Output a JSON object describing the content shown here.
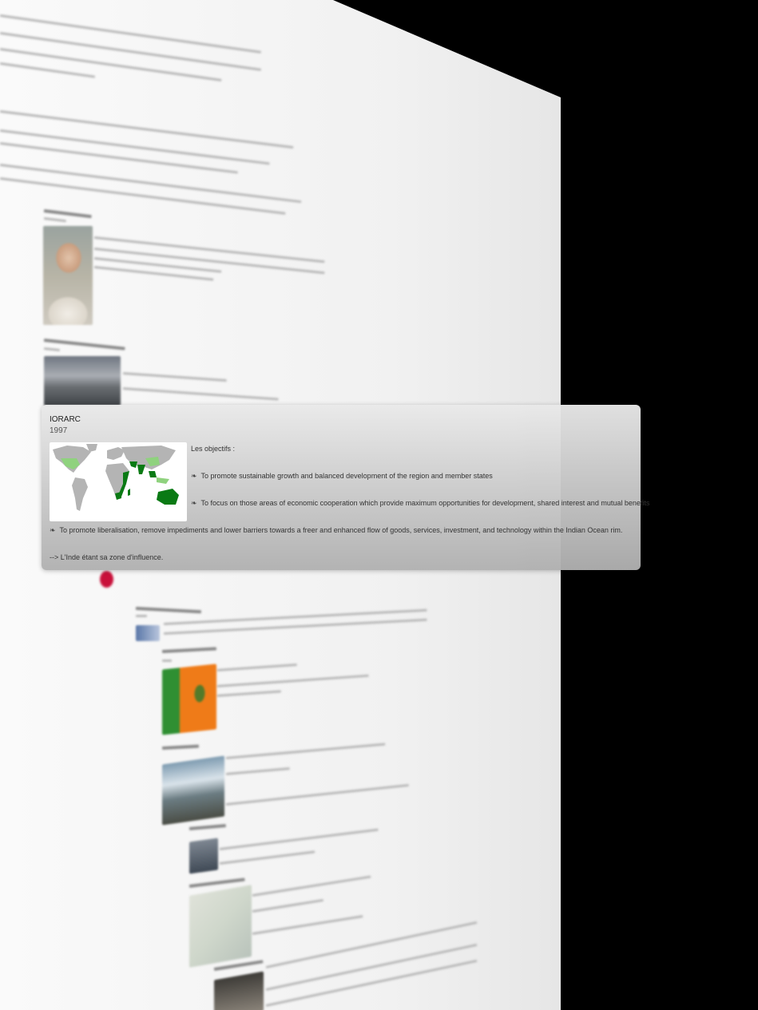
{
  "popup": {
    "title": "IORARC",
    "year": "1997",
    "intro": "Les objectifs :",
    "objectives": [
      "To promote sustainable growth and balanced development of the region  and member states",
      "To focus on those areas of economic cooperation which provide maximum  opportunities for development, shared interest and mutual benefits",
      "To promote liberalisation, remove impediments and lower barriers towards  a freer and enhanced flow of goods, services, investment, and technology  within the Indian Ocean rim."
    ],
    "bullet_glyph": "❧",
    "footer": "--> L'Inde étant sa zone d'influence."
  },
  "background": {
    "section_blocks": 9
  },
  "colors": {
    "card_top": "#e9e9e9",
    "card_bottom": "#b0b0b0",
    "map_land": "#b4b4b4",
    "map_member_dark": "#0a7a14",
    "map_member_light": "#8fd27e",
    "accent_red": "#c8103a"
  }
}
